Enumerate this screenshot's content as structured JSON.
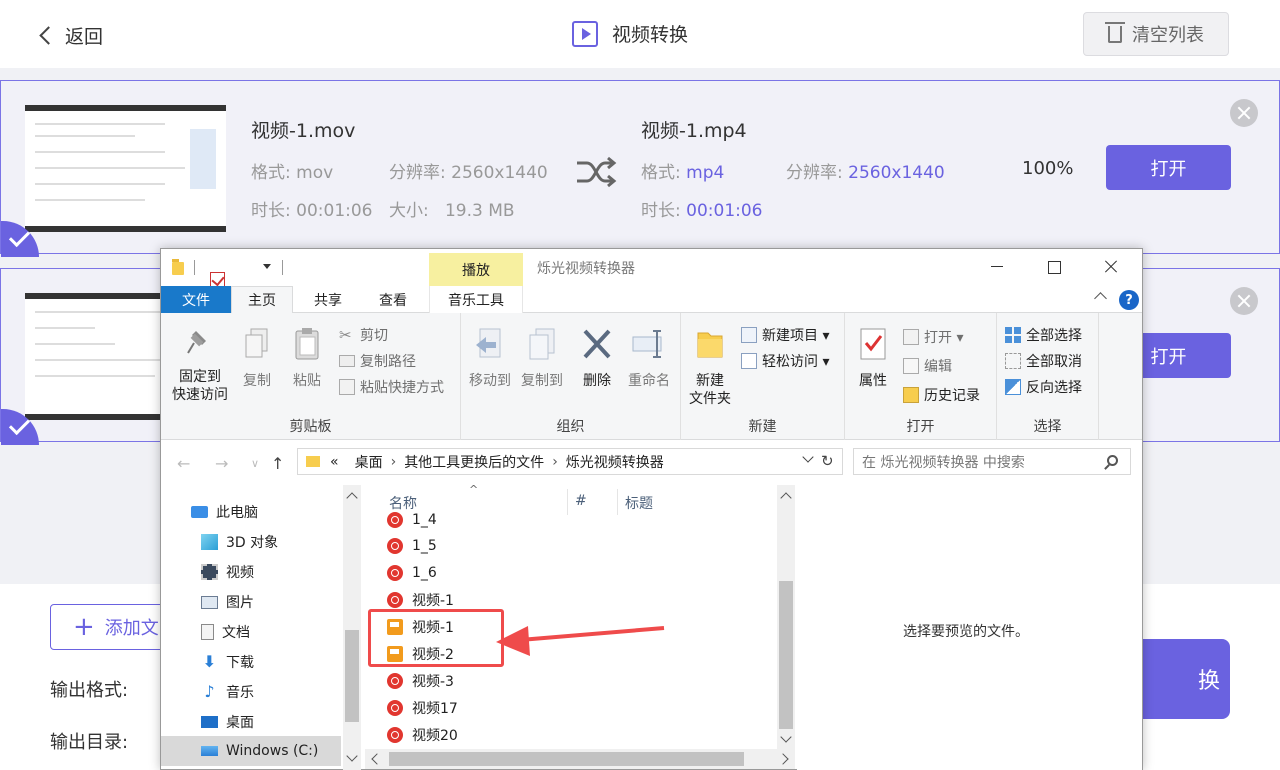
{
  "app": {
    "back_label": "返回",
    "title": "视频转换",
    "clear_label": "清空列表"
  },
  "items": [
    {
      "source_name": "视频-1.mov",
      "format_label": "格式:",
      "source_format": "mov",
      "resolution_label": "分辨率:",
      "source_resolution": "2560x1440",
      "duration_label": "时长:",
      "source_duration": "00:01:06",
      "size_label": "大小:",
      "source_size": "19.3 MB",
      "output_name": "视频-1.mp4",
      "output_format": "mp4",
      "output_resolution": "2560x1440",
      "output_duration": "00:01:06",
      "progress": "100%",
      "open_label": "打开"
    },
    {
      "open_label": "打开"
    }
  ],
  "bottom": {
    "add_label": "添加文",
    "output_format_label": "输出格式:",
    "output_dir_label": "输出目录:",
    "convert_label_partial": "换"
  },
  "explorer": {
    "context_tab": "播放",
    "window_title": "烁光视频转换器",
    "tabs": [
      "文件",
      "主页",
      "共享",
      "查看",
      "音乐工具"
    ],
    "help": "?",
    "ribbon": {
      "clipboard": {
        "pin_line1": "固定到",
        "pin_line2": "快速访问",
        "copy": "复制",
        "paste": "粘贴",
        "cut": "剪切",
        "copy_path": "复制路径",
        "paste_shortcut": "粘贴快捷方式",
        "group": "剪贴板"
      },
      "organize": {
        "move_to": "移动到",
        "copy_to": "复制到",
        "delete": "删除",
        "rename": "重命名",
        "group": "组织"
      },
      "new": {
        "new_folder_line1": "新建",
        "new_folder_line2": "文件夹",
        "new_item": "新建项目 ▾",
        "easy_access": "轻松访问 ▾",
        "group": "新建"
      },
      "open": {
        "properties": "属性",
        "open": "打开 ▾",
        "edit": "编辑",
        "history": "历史记录",
        "group": "打开"
      },
      "select": {
        "select_all": "全部选择",
        "select_none": "全部取消",
        "invert": "反向选择",
        "group": "选择"
      }
    },
    "address": {
      "chevrons": "«",
      "crumbs": [
        "桌面",
        "其他工具更换后的文件",
        "烁光视频转换器"
      ],
      "search_placeholder": "在 烁光视频转换器 中搜索"
    },
    "nav": [
      {
        "label": "此电脑",
        "icon": "computer-icon"
      },
      {
        "label": "3D 对象",
        "icon": "cube-icon"
      },
      {
        "label": "视频",
        "icon": "film-icon"
      },
      {
        "label": "图片",
        "icon": "picture-icon"
      },
      {
        "label": "文档",
        "icon": "document-icon"
      },
      {
        "label": "下载",
        "icon": "download-icon"
      },
      {
        "label": "音乐",
        "icon": "music-icon"
      },
      {
        "label": "桌面",
        "icon": "desktop-icon"
      },
      {
        "label": "Windows (C:)",
        "icon": "drive-icon"
      }
    ],
    "columns": [
      "名称",
      "#",
      "标题"
    ],
    "files": [
      {
        "name": "1_4",
        "icon": "netease-music-icon"
      },
      {
        "name": "1_5",
        "icon": "netease-music-icon"
      },
      {
        "name": "1_6",
        "icon": "netease-music-icon"
      },
      {
        "name": "视频-1",
        "icon": "netease-music-icon"
      },
      {
        "name": "视频-1",
        "icon": "video-file-icon"
      },
      {
        "name": "视频-2",
        "icon": "video-file-icon"
      },
      {
        "name": "视频-3",
        "icon": "netease-music-icon"
      },
      {
        "name": "视频17",
        "icon": "netease-music-icon"
      },
      {
        "name": "视频20",
        "icon": "netease-music-icon"
      }
    ],
    "preview_text": "选择要预览的文件。"
  },
  "colors": {
    "accent": "#6a62e0",
    "file_tab": "#1979ca",
    "context_tab": "#f7f0a0",
    "annotation": "#ef4b4b"
  }
}
